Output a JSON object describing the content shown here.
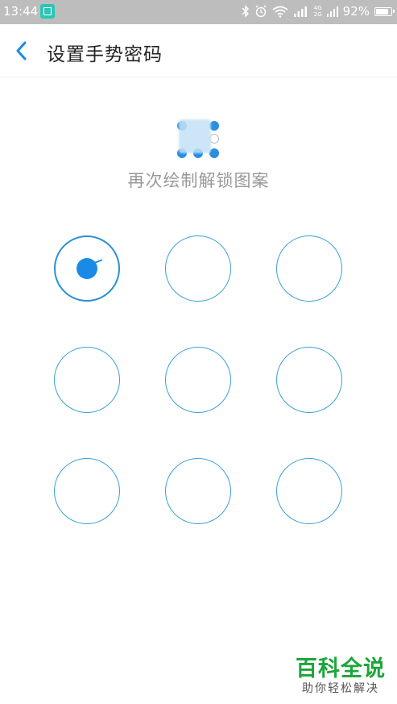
{
  "status_bar": {
    "time": "13:44",
    "net_top": "4G",
    "net_bottom": "2G",
    "battery": "92%",
    "battery_level": 0.92,
    "icons": [
      "scan-app-icon",
      "bluetooth-icon",
      "alarm-icon",
      "wifi-icon",
      "signal-icon",
      "battery-icon"
    ]
  },
  "header": {
    "title": "设置手势密码",
    "back_icon": "chevron-left-icon"
  },
  "instruction": "再次绘制解锁图案",
  "pattern_grid": {
    "nodes": [
      {
        "row": 1,
        "col": 1,
        "state": "active"
      },
      {
        "row": 1,
        "col": 2,
        "state": "idle"
      },
      {
        "row": 1,
        "col": 3,
        "state": "idle"
      },
      {
        "row": 2,
        "col": 1,
        "state": "idle"
      },
      {
        "row": 2,
        "col": 2,
        "state": "idle"
      },
      {
        "row": 2,
        "col": 3,
        "state": "idle"
      },
      {
        "row": 3,
        "col": 1,
        "state": "idle"
      },
      {
        "row": 3,
        "col": 2,
        "state": "idle"
      },
      {
        "row": 3,
        "col": 3,
        "state": "idle"
      }
    ]
  },
  "colors": {
    "accent": "#1a8ae6",
    "circle_stroke": "#3aa0d6",
    "status_bar_bg": "#bdbdbd",
    "watermark_green": "#1ea53a"
  },
  "watermark": {
    "main": "百科全说",
    "sub": "助你轻松解决"
  }
}
